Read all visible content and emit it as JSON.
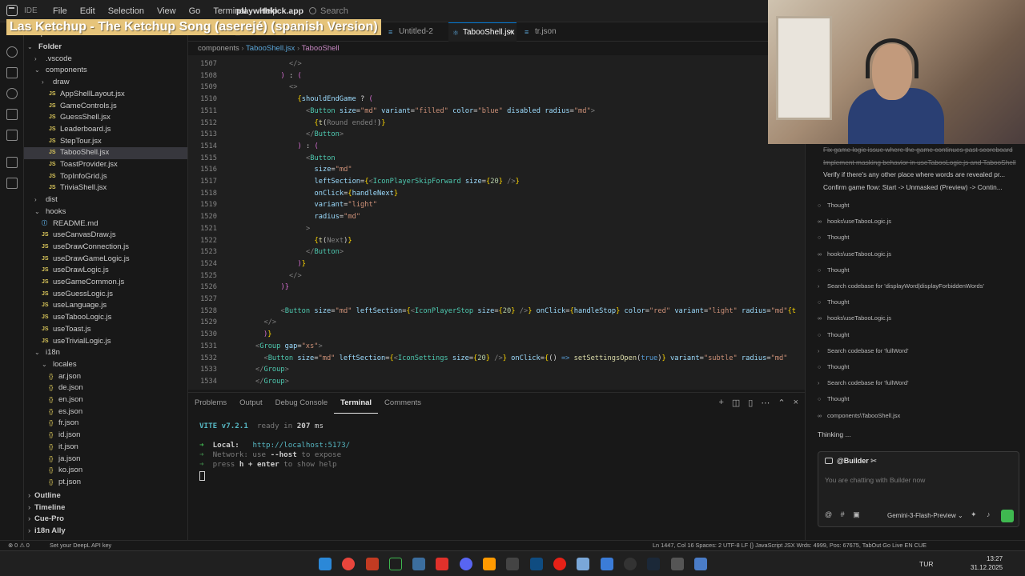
{
  "titlebar": {
    "ide_label": "IDE",
    "menus": [
      "File",
      "Edit",
      "Selection",
      "View",
      "Go",
      "Terminal",
      "Help"
    ],
    "project": "playwithkick.app",
    "search_placeholder": "Search"
  },
  "banner": "Las Ketchup - The Ketchup Song (aserejé) (spanish Version)",
  "explorer": {
    "header": "Explorer",
    "rows": [
      {
        "label": "Folder",
        "depth": 0,
        "kind": "root",
        "arrow": ""
      },
      {
        "label": ".vscode",
        "depth": 1,
        "kind": "folder",
        "arrow": "›"
      },
      {
        "label": "components",
        "depth": 1,
        "kind": "folder",
        "arrow": "⌄"
      },
      {
        "label": "draw",
        "depth": 2,
        "kind": "folder",
        "arrow": "›"
      },
      {
        "label": "AppShellLayout.jsx",
        "depth": 3,
        "kind": "js"
      },
      {
        "label": "GameControls.js",
        "depth": 3,
        "kind": "js"
      },
      {
        "label": "GuessShell.jsx",
        "depth": 3,
        "kind": "js"
      },
      {
        "label": "Leaderboard.js",
        "depth": 3,
        "kind": "js"
      },
      {
        "label": "StepTour.jsx",
        "depth": 3,
        "kind": "js"
      },
      {
        "label": "TabooShell.jsx",
        "depth": 3,
        "kind": "js",
        "selected": true
      },
      {
        "label": "ToastProvider.jsx",
        "depth": 3,
        "kind": "js"
      },
      {
        "label": "TopInfoGrid.js",
        "depth": 3,
        "kind": "js"
      },
      {
        "label": "TriviaShell.jsx",
        "depth": 3,
        "kind": "js"
      },
      {
        "label": "dist",
        "depth": 1,
        "kind": "folder",
        "arrow": "›"
      },
      {
        "label": "hooks",
        "depth": 1,
        "kind": "folder",
        "arrow": "⌄"
      },
      {
        "label": "README.md",
        "depth": 2,
        "kind": "md"
      },
      {
        "label": "useCanvasDraw.js",
        "depth": 2,
        "kind": "js"
      },
      {
        "label": "useDrawConnection.js",
        "depth": 2,
        "kind": "js"
      },
      {
        "label": "useDrawGameLogic.js",
        "depth": 2,
        "kind": "js"
      },
      {
        "label": "useDrawLogic.js",
        "depth": 2,
        "kind": "js"
      },
      {
        "label": "useGameCommon.js",
        "depth": 2,
        "kind": "js"
      },
      {
        "label": "useGuessLogic.js",
        "depth": 2,
        "kind": "js"
      },
      {
        "label": "useLanguage.js",
        "depth": 2,
        "kind": "js"
      },
      {
        "label": "useTabooLogic.js",
        "depth": 2,
        "kind": "js"
      },
      {
        "label": "useToast.js",
        "depth": 2,
        "kind": "js"
      },
      {
        "label": "useTrivialLogic.js",
        "depth": 2,
        "kind": "js"
      },
      {
        "label": "i18n",
        "depth": 1,
        "kind": "folder",
        "arrow": "⌄"
      },
      {
        "label": "locales",
        "depth": 2,
        "kind": "folder",
        "arrow": "⌄"
      },
      {
        "label": "ar.json",
        "depth": 3,
        "kind": "json"
      },
      {
        "label": "de.json",
        "depth": 3,
        "kind": "json"
      },
      {
        "label": "en.json",
        "depth": 3,
        "kind": "json"
      },
      {
        "label": "es.json",
        "depth": 3,
        "kind": "json"
      },
      {
        "label": "fr.json",
        "depth": 3,
        "kind": "json"
      },
      {
        "label": "id.json",
        "depth": 3,
        "kind": "json"
      },
      {
        "label": "it.json",
        "depth": 3,
        "kind": "json"
      },
      {
        "label": "ja.json",
        "depth": 3,
        "kind": "json"
      },
      {
        "label": "ko.json",
        "depth": 3,
        "kind": "json"
      },
      {
        "label": "pt.json",
        "depth": 3,
        "kind": "json"
      }
    ],
    "sections": [
      "Outline",
      "Timeline",
      "Cue-Pro",
      "i18n Ally"
    ]
  },
  "tabs": [
    {
      "label": "prompt_...",
      "active": false
    },
    {
      "label": "todo.txt",
      "active": false
    },
    {
      "label": "Untitled-1",
      "active": false
    },
    {
      "label": "Untitled-2",
      "active": false
    },
    {
      "label": "TabooShell.jsx",
      "active": true,
      "close": "×"
    },
    {
      "label": "tr.json",
      "active": false
    }
  ],
  "breadcrumb": [
    "components",
    "TabooShell.jsx",
    "TabooShell"
  ],
  "code": [
    {
      "n": "1507",
      "i": 2,
      "h": "<span class=g>&lt;/&gt;</span>"
    },
    {
      "n": "1508",
      "i": 1,
      "h": "<span class=p>)</span> : <span class=p>(</span>"
    },
    {
      "n": "1509",
      "i": 2,
      "h": "<span class=g>&lt;&gt;</span>"
    },
    {
      "n": "1510",
      "i": 3,
      "h": "<span class=b>{</span><span class=a>shouldEndGame</span> ? <span class=p>(</span>"
    },
    {
      "n": "1511",
      "i": 4,
      "h": "<span class=g>&lt;</span><span class=t>Button</span> <span class=a>size</span>=<span class=s>\"md\"</span> <span class=a>variant</span>=<span class=s>\"filled\"</span> <span class=a>color</span>=<span class=s>\"blue\"</span> <span class=a>disabled</span> <span class=a>radius</span>=<span class=s>\"md\"</span><span class=g>&gt;</span>"
    },
    {
      "n": "1512",
      "i": 5,
      "h": "<span class=b>{</span><span class=f>t</span>(<span class=g>Round ended!</span>)<span class=b>}</span>"
    },
    {
      "n": "1513",
      "i": 4,
      "h": "<span class=g>&lt;/</span><span class=t>Button</span><span class=g>&gt;</span>"
    },
    {
      "n": "1514",
      "i": 3,
      "h": "<span class=p>)</span> : <span class=p>(</span>"
    },
    {
      "n": "1515",
      "i": 4,
      "h": "<span class=g>&lt;</span><span class=t>Button</span>"
    },
    {
      "n": "1516",
      "i": 5,
      "h": "<span class=a>size</span>=<span class=s>\"md\"</span>"
    },
    {
      "n": "1517",
      "i": 5,
      "h": "<span class=a>leftSection</span>=<span class=b>{</span><span class=g>&lt;</span><span class=t>IconPlayerSkipForward</span> <span class=a>size</span>=<span class=b>{</span><span class=n>20</span><span class=b>}</span> <span class=g>/&gt;</span><span class=b>}</span>"
    },
    {
      "n": "1518",
      "i": 5,
      "h": "<span class=a>onClick</span>=<span class=b>{</span><span class=a>handleNext</span><span class=b>}</span>"
    },
    {
      "n": "1519",
      "i": 5,
      "h": "<span class=a>variant</span>=<span class=s>\"light\"</span>"
    },
    {
      "n": "1520",
      "i": 5,
      "h": "<span class=a>radius</span>=<span class=s>\"md\"</span>"
    },
    {
      "n": "1521",
      "i": 4,
      "h": "<span class=g>&gt;</span>"
    },
    {
      "n": "1522",
      "i": 5,
      "h": "<span class=b>{</span><span class=f>t</span>(<span class=g>Next</span>)<span class=b>}</span>"
    },
    {
      "n": "1523",
      "i": 4,
      "h": "<span class=g>&lt;/</span><span class=t>Button</span><span class=g>&gt;</span>"
    },
    {
      "n": "1524",
      "i": 3,
      "h": "<span class=p>)</span><span class=b>}</span>"
    },
    {
      "n": "1525",
      "i": 2,
      "h": "<span class=g>&lt;/&gt;</span>"
    },
    {
      "n": "1526",
      "i": 1,
      "h": "<span class=p>)</span><span class=p>}</span>"
    },
    {
      "n": "1527",
      "i": 0,
      "h": ""
    },
    {
      "n": "1528",
      "i": 1,
      "h": "<span class=g>&lt;</span><span class=t>Button</span> <span class=a>size</span>=<span class=s>\"md\"</span> <span class=a>leftSection</span>=<span class=b>{</span><span class=g>&lt;</span><span class=t>IconPlayerStop</span> <span class=a>size</span>=<span class=b>{</span><span class=n>20</span><span class=b>}</span> <span class=g>/&gt;</span><span class=b>}</span> <span class=a>onClick</span>=<span class=b>{</span><span class=a>handleStop</span><span class=b>}</span> <span class=a>color</span>=<span class=s>\"red\"</span> <span class=a>variant</span>=<span class=s>\"light\"</span> <span class=a>radius</span>=<span class=s>\"md\"</span><span class=b>{t</span>"
    },
    {
      "n": "1529",
      "i": 0,
      "h": "  <span class=g>&lt;/&gt;</span>"
    },
    {
      "n": "1530",
      "i": 0,
      "h": "<span class=p>)</span><span class=b>}</span>"
    },
    {
      "n": "1531",
      "i": 0,
      "h": "<span class=g>&lt;</span><span class=t>Group</span> <span class=a>gap</span>=<span class=s>\"xs\"</span><span class=g>&gt;</span>"
    },
    {
      "n": "1532",
      "i": 0,
      "h": "  <span class=g>&lt;</span><span class=t>Button</span> <span class=a>size</span>=<span class=s>\"md\"</span> <span class=a>leftSection</span>=<span class=b>{</span><span class=g>&lt;</span><span class=t>IconSettings</span> <span class=a>size</span>=<span class=b>{</span><span class=n>20</span><span class=b>}</span> <span class=g>/&gt;</span><span class=b>}</span> <span class=a>onClick</span>=<span class=b>{</span>() <span class=k>=&gt;</span> <span class=f>setSettingsOpen</span>(<span class=k>true</span>)<span class=b>}</span> <span class=a>variant</span>=<span class=s>\"subtle\"</span> <span class=a>radius</span>=<span class=s>\"md\"</span>"
    },
    {
      "n": "1533",
      "i": 0,
      "h": "<span class=g>&lt;/</span><span class=t>Group</span><span class=g>&gt;</span>"
    },
    {
      "n": "1534",
      "i": 0,
      "h": "<span class=g>&lt;/</span><span class=t>Group</span><span class=g>&gt;</span>"
    }
  ],
  "panel": {
    "tabs": [
      "Problems",
      "Output",
      "Debug Console",
      "Terminal",
      "Comments"
    ],
    "active_tab": "Terminal",
    "terminal": {
      "vite": "VITE v7.2.1",
      "ready": "ready in",
      "ms_value": "207",
      "ms": "ms",
      "local_label": "Local:",
      "local_url": "http://localhost:5173/",
      "network_label": "Network: use",
      "network_flag": "--host",
      "network_tail": "to expose",
      "help_a": "press",
      "help_b": "h + enter",
      "help_c": "to show help"
    }
  },
  "chat": {
    "todos": [
      {
        "text": "Fix game logic issue where the game continues past scoreboard",
        "state": "done"
      },
      {
        "text": "Implement masking behavior in useTabooLogic.js and TabooShell",
        "state": "done"
      },
      {
        "text": "Verify if there's any other place where words are revealed pr...",
        "state": "prog"
      },
      {
        "text": "Confirm game flow: Start -> Unmasked (Preview) -> Contin...",
        "state": "open"
      }
    ],
    "activity": [
      {
        "icon": "○",
        "text": "Thought"
      },
      {
        "icon": "∞",
        "text": "hooks\\useTabooLogic.js"
      },
      {
        "icon": "○",
        "text": "Thought"
      },
      {
        "icon": "∞",
        "text": "hooks\\useTabooLogic.js"
      },
      {
        "icon": "○",
        "text": "Thought"
      },
      {
        "icon": "›",
        "text": "Search codebase for 'displayWord|displayForbiddenWords'"
      },
      {
        "icon": "○",
        "text": "Thought"
      },
      {
        "icon": "∞",
        "text": "hooks\\useTabooLogic.js"
      },
      {
        "icon": "○",
        "text": "Thought"
      },
      {
        "icon": "›",
        "text": "Search codebase for 'fullWord'"
      },
      {
        "icon": "○",
        "text": "Thought"
      },
      {
        "icon": "›",
        "text": "Search codebase for 'fullWord'"
      },
      {
        "icon": "○",
        "text": "Thought"
      },
      {
        "icon": "∞",
        "text": "components\\TabooShell.jsx"
      }
    ],
    "thinking": "Thinking ...",
    "composer": {
      "agent": "@Builder",
      "placeholder": "You are chatting with Builder now",
      "model": "Gemini-3-Flash-Preview"
    }
  },
  "status": {
    "left": "⊗ 0 ⚠ 0",
    "deepl": "Set your DeepL API key",
    "right": "Ln 1447, Col 16    Spaces: 2    UTF-8    LF    {} JavaScript JSX    Wrds: 4999, Pos: 67675, TabOut    Go Live    EN    CUE"
  },
  "taskbar": {
    "lang": "TUR",
    "time": "13:27",
    "date": "31.12.2025"
  }
}
